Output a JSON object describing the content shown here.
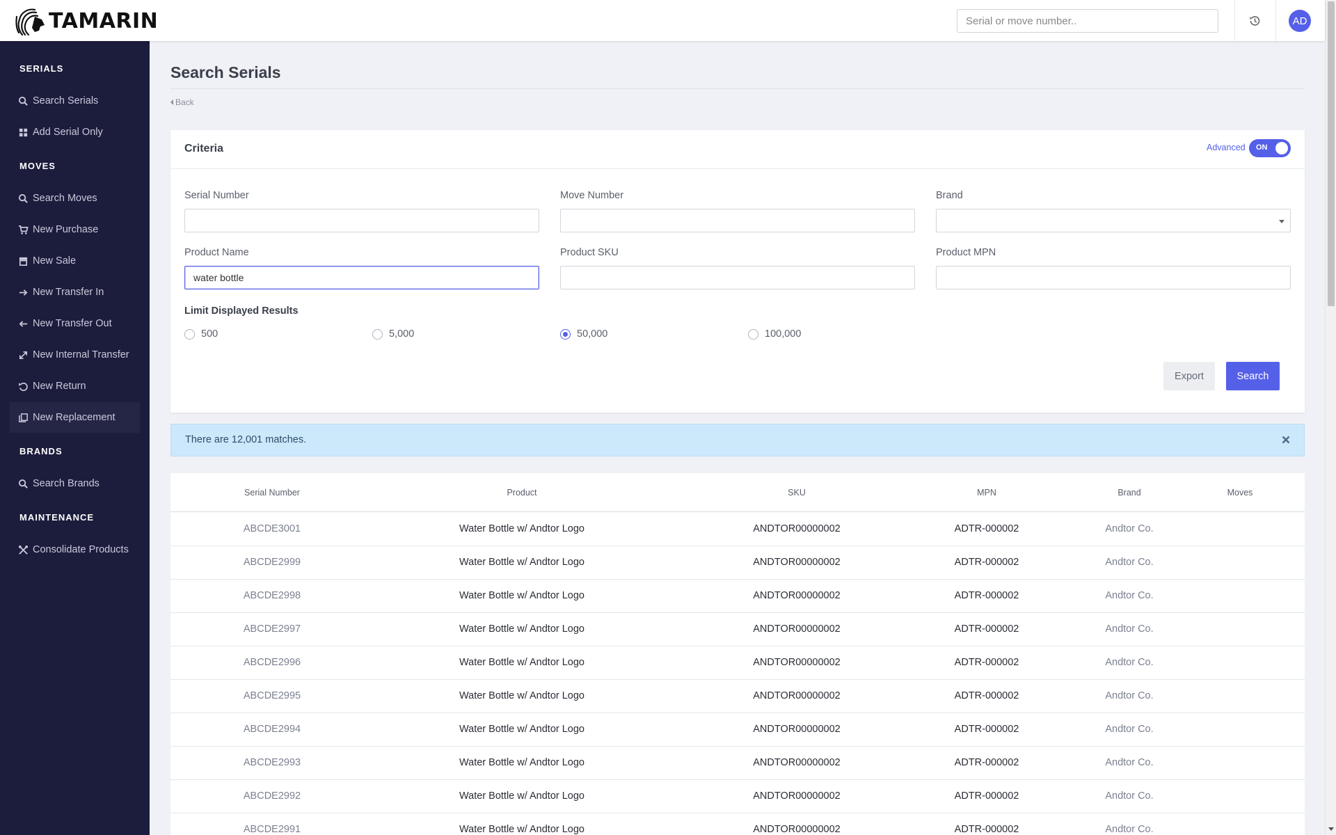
{
  "header": {
    "brand_name": "TAMARIN",
    "search_placeholder": "Serial or move number..",
    "avatar_initials": "AD"
  },
  "sidebar": {
    "sections": [
      {
        "title": "SERIALS",
        "items": [
          {
            "label": "Search Serials",
            "icon": "search-icon"
          },
          {
            "label": "Add Serial Only",
            "icon": "grid-icon"
          }
        ]
      },
      {
        "title": "MOVES",
        "items": [
          {
            "label": "Search Moves",
            "icon": "search-icon"
          },
          {
            "label": "New Purchase",
            "icon": "cart-icon"
          },
          {
            "label": "New Sale",
            "icon": "store-icon"
          },
          {
            "label": "New Transfer In",
            "icon": "arrow-right-icon"
          },
          {
            "label": "New Transfer Out",
            "icon": "arrow-left-icon"
          },
          {
            "label": "New Internal Transfer",
            "icon": "swap-icon"
          },
          {
            "label": "New Return",
            "icon": "undo-icon"
          },
          {
            "label": "New Replacement",
            "icon": "copy-icon"
          }
        ]
      },
      {
        "title": "BRANDS",
        "items": [
          {
            "label": "Search Brands",
            "icon": "search-icon"
          }
        ]
      },
      {
        "title": "MAINTENANCE",
        "items": [
          {
            "label": "Consolidate Products",
            "icon": "tools-icon"
          }
        ]
      }
    ],
    "active_item": "New Replacement"
  },
  "page": {
    "title": "Search Serials",
    "back_label": "Back"
  },
  "criteria": {
    "title": "Criteria",
    "advanced_label": "Advanced",
    "advanced_toggle": "ON",
    "fields": {
      "serial_number": {
        "label": "Serial Number",
        "value": ""
      },
      "move_number": {
        "label": "Move Number",
        "value": ""
      },
      "brand": {
        "label": "Brand",
        "value": ""
      },
      "product_name": {
        "label": "Product Name",
        "value": "water bottle"
      },
      "product_sku": {
        "label": "Product SKU",
        "value": ""
      },
      "product_mpn": {
        "label": "Product MPN",
        "value": ""
      }
    },
    "limit_label": "Limit Displayed Results",
    "limit_options": [
      "500",
      "5,000",
      "50,000",
      "100,000"
    ],
    "limit_selected": "50,000",
    "export_label": "Export",
    "search_label": "Search"
  },
  "alert": {
    "message": "There are 12,001 matches."
  },
  "results": {
    "columns": [
      "Serial Number",
      "Product",
      "SKU",
      "MPN",
      "Brand",
      "Moves"
    ],
    "rows": [
      {
        "serial": "ABCDE3001",
        "product": "Water Bottle w/ Andtor Logo",
        "sku": "ANDTOR00000002",
        "mpn": "ADTR-000002",
        "brand": "Andtor Co.",
        "moves": ""
      },
      {
        "serial": "ABCDE2999",
        "product": "Water Bottle w/ Andtor Logo",
        "sku": "ANDTOR00000002",
        "mpn": "ADTR-000002",
        "brand": "Andtor Co.",
        "moves": ""
      },
      {
        "serial": "ABCDE2998",
        "product": "Water Bottle w/ Andtor Logo",
        "sku": "ANDTOR00000002",
        "mpn": "ADTR-000002",
        "brand": "Andtor Co.",
        "moves": ""
      },
      {
        "serial": "ABCDE2997",
        "product": "Water Bottle w/ Andtor Logo",
        "sku": "ANDTOR00000002",
        "mpn": "ADTR-000002",
        "brand": "Andtor Co.",
        "moves": ""
      },
      {
        "serial": "ABCDE2996",
        "product": "Water Bottle w/ Andtor Logo",
        "sku": "ANDTOR00000002",
        "mpn": "ADTR-000002",
        "brand": "Andtor Co.",
        "moves": ""
      },
      {
        "serial": "ABCDE2995",
        "product": "Water Bottle w/ Andtor Logo",
        "sku": "ANDTOR00000002",
        "mpn": "ADTR-000002",
        "brand": "Andtor Co.",
        "moves": ""
      },
      {
        "serial": "ABCDE2994",
        "product": "Water Bottle w/ Andtor Logo",
        "sku": "ANDTOR00000002",
        "mpn": "ADTR-000002",
        "brand": "Andtor Co.",
        "moves": ""
      },
      {
        "serial": "ABCDE2993",
        "product": "Water Bottle w/ Andtor Logo",
        "sku": "ANDTOR00000002",
        "mpn": "ADTR-000002",
        "brand": "Andtor Co.",
        "moves": ""
      },
      {
        "serial": "ABCDE2992",
        "product": "Water Bottle w/ Andtor Logo",
        "sku": "ANDTOR00000002",
        "mpn": "ADTR-000002",
        "brand": "Andtor Co.",
        "moves": ""
      },
      {
        "serial": "ABCDE2991",
        "product": "Water Bottle w/ Andtor Logo",
        "sku": "ANDTOR00000002",
        "mpn": "ADTR-000002",
        "brand": "Andtor Co.",
        "moves": ""
      }
    ]
  },
  "colors": {
    "accent": "#5560e8",
    "sidebar_bg": "#1c1c3c",
    "alert_bg": "#cce8fb",
    "page_bg": "#f0f1f6"
  }
}
